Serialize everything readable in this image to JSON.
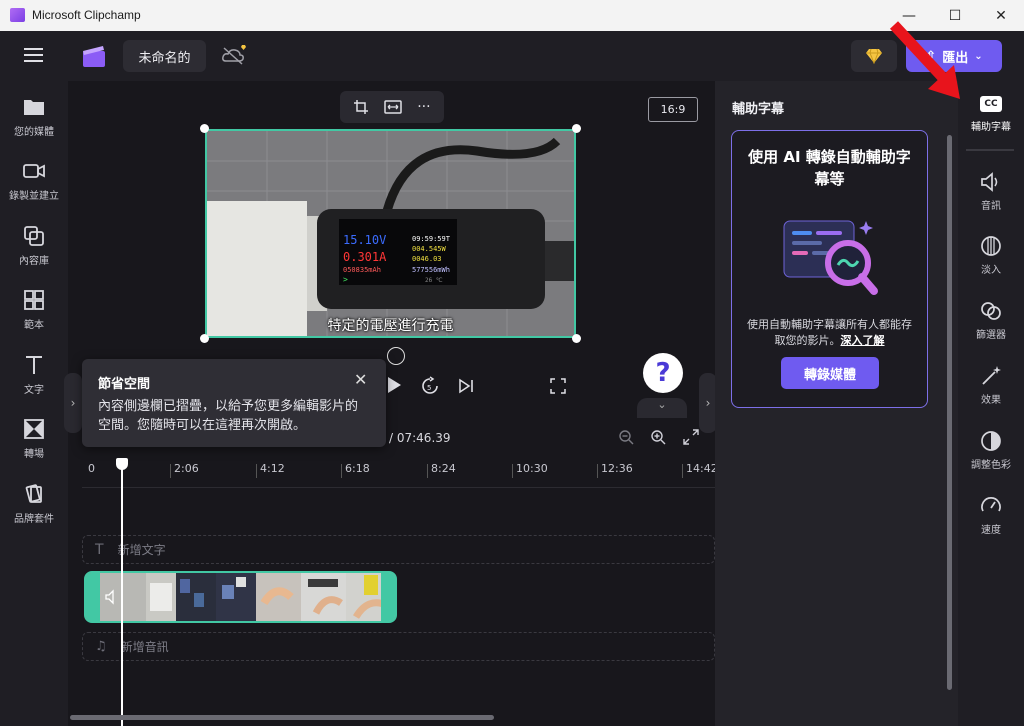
{
  "window": {
    "title": "Microsoft Clipchamp",
    "min": "—",
    "max": "☐",
    "close": "✕"
  },
  "header": {
    "project_name": "未命名的",
    "export_label": "匯出"
  },
  "left_sidebar": [
    {
      "label": "您的媒體",
      "icon": "folder-icon"
    },
    {
      "label": "錄製並建立",
      "icon": "camera-icon"
    },
    {
      "label": "內容庫",
      "icon": "library-icon"
    },
    {
      "label": "範本",
      "icon": "templates-icon"
    },
    {
      "label": "文字",
      "icon": "text-icon"
    },
    {
      "label": "轉場",
      "icon": "transitions-icon"
    },
    {
      "label": "品牌套件",
      "icon": "brand-kit-icon"
    }
  ],
  "preview": {
    "aspect_ratio": "16:9",
    "subtitle": "特定的電壓進行充電",
    "meter": {
      "voltage": "15.10V",
      "current": "0.301A",
      "mah": "050835mAh",
      "time": "09:59:59T",
      "watt": "004.545W",
      "wh": "0046.03",
      "mwh": "577556mWh",
      "temp": "26 ℃"
    }
  },
  "tooltip": {
    "title": "節省空間",
    "body": "內容側邊欄已摺疊，以給予您更多編輯影片的空間。您隨時可以在這裡再次開啟。"
  },
  "timeline": {
    "timecode_total": "/ 07:46.39",
    "ticks": [
      "0",
      "2:06",
      "4:12",
      "6:18",
      "8:24",
      "10:30",
      "12:36",
      "14:42"
    ],
    "text_track_placeholder": "新增文字",
    "audio_track_placeholder": "新增音訊"
  },
  "right_panel": {
    "title": "輔助字幕",
    "card_heading": "使用 AI 轉錄自動輔助字幕等",
    "card_desc": "使用自動輔助字幕讓所有人都能存取您的影片。",
    "learn_more": "深入了解",
    "transcribe_button": "轉錄媒體"
  },
  "right_rail": [
    {
      "label": "輔助字幕",
      "icon": "cc-icon"
    },
    {
      "label": "音訊",
      "icon": "speaker-icon"
    },
    {
      "label": "淡入",
      "icon": "fade-icon"
    },
    {
      "label": "篩選器",
      "icon": "filters-icon"
    },
    {
      "label": "效果",
      "icon": "effects-wand-icon"
    },
    {
      "label": "調整色彩",
      "icon": "color-adjust-icon"
    },
    {
      "label": "速度",
      "icon": "speed-icon"
    }
  ],
  "colors": {
    "accent": "#6f5bf0",
    "selection": "#42c8a4",
    "annotation_arrow": "#e8141c"
  }
}
